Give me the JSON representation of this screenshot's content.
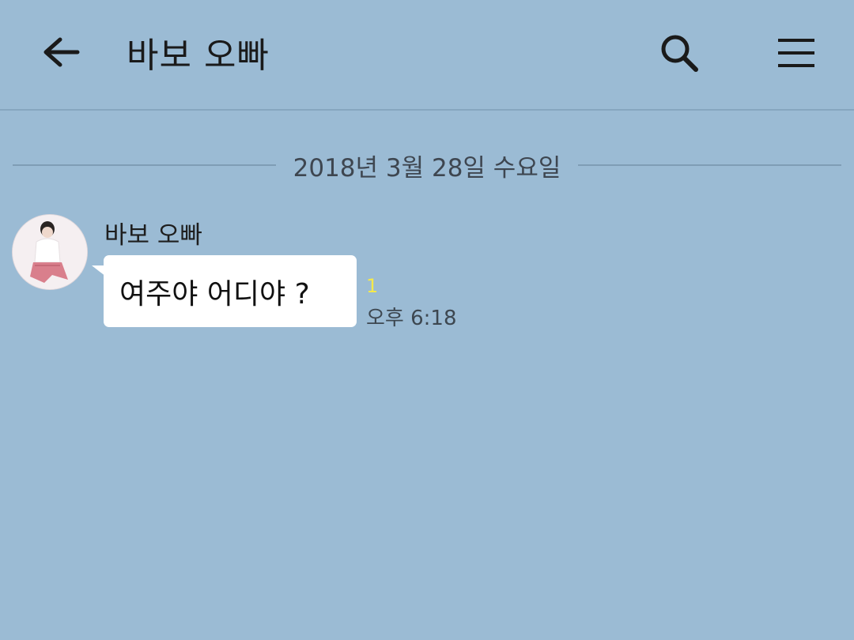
{
  "header": {
    "title": "바보 오빠",
    "back_icon": "arrow-left-icon",
    "search_icon": "search-icon",
    "menu_icon": "hamburger-menu-icon"
  },
  "chat": {
    "date_divider": "2018년 3월 28일 수요일",
    "messages": [
      {
        "sender": "바보 오빠",
        "avatar_icon": "profile-photo",
        "text": "여주야 어디야 ?",
        "unread": "1",
        "time": "오후 6:18"
      }
    ]
  },
  "colors": {
    "background": "#9bbbd4",
    "bubble": "#ffffff",
    "unread": "#f5e94a",
    "text": "#1a1a1a"
  }
}
